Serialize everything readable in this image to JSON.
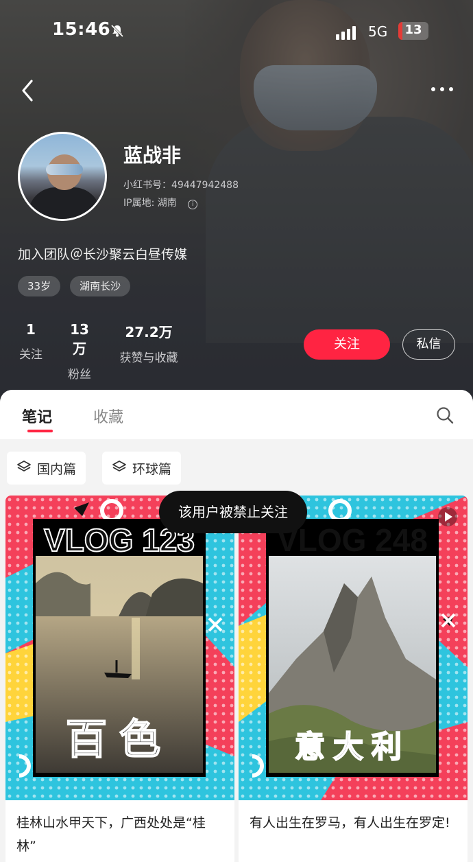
{
  "status_bar": {
    "time": "15:46",
    "network": "5G",
    "battery": "13",
    "battery_level": 0.13
  },
  "profile": {
    "name": "蓝战非",
    "id_line": "小红书号：49447942488",
    "ip_line": "IP属地: 湖南",
    "bio": "加入团队＠长沙聚云白昼传媒",
    "tags": [
      "33岁",
      "湖南长沙"
    ]
  },
  "stats": [
    {
      "num": "1",
      "label": "关注"
    },
    {
      "num": "13万",
      "label": "粉丝"
    },
    {
      "num": "27.2万",
      "label": "获赞与收藏"
    }
  ],
  "actions": {
    "follow": "关注",
    "message": "私信"
  },
  "tabs": {
    "notes": "笔记",
    "collections": "收藏"
  },
  "albums": [
    "国内篇",
    "环球篇"
  ],
  "toast": "该用户被禁止关注",
  "notes": [
    {
      "cover_title": "VLOG 123",
      "cover_place": "百色",
      "title": "桂林山水甲天下，广西处处是“桂林”"
    },
    {
      "cover_title": "VLOG 248",
      "cover_place": "意大利",
      "title": "有人出生在罗马，有人出生在罗定!"
    }
  ],
  "colors": {
    "accent": "#ff2442",
    "cover_pink": "#f4405a",
    "cover_cyan": "#2ec4de",
    "cover_yellow": "#ffd43b"
  },
  "icons": [
    "back-arrow-icon",
    "more-dots-icon",
    "bell-mute-icon",
    "search-icon",
    "layers-icon",
    "play-icon",
    "close-x-icon"
  ]
}
